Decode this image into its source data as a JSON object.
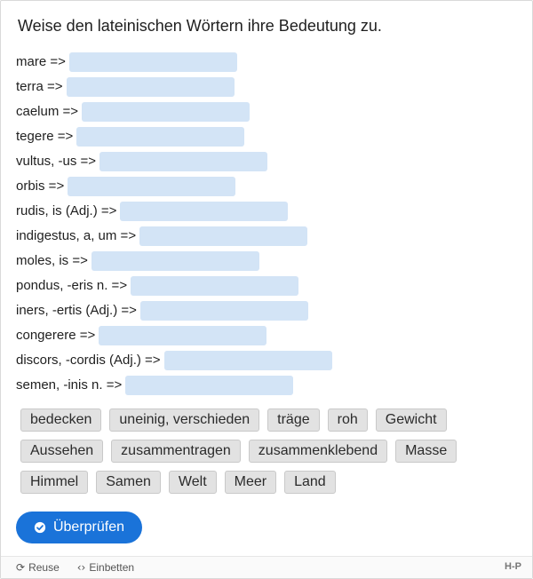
{
  "task": {
    "title": "Weise den lateinischen Wörtern ihre Bedeutung zu."
  },
  "rows": [
    {
      "word": "mare =>"
    },
    {
      "word": "terra =>"
    },
    {
      "word": "caelum =>"
    },
    {
      "word": "tegere =>"
    },
    {
      "word": "vultus, -us =>"
    },
    {
      "word": "orbis =>"
    },
    {
      "word": "rudis, is (Adj.) =>"
    },
    {
      "word": "indigestus, a, um =>"
    },
    {
      "word": "moles, is =>"
    },
    {
      "word": "pondus, -eris n. =>"
    },
    {
      "word": "iners, -ertis (Adj.) =>"
    },
    {
      "word": "congerere =>"
    },
    {
      "word": "discors, -cordis (Adj.) =>"
    },
    {
      "word": "semen, -inis n. =>"
    }
  ],
  "chips": [
    [
      "bedecken",
      "uneinig, verschieden",
      "träge",
      "roh",
      "Gewicht"
    ],
    [
      "Aussehen",
      "zusammentragen",
      "zusammenklebend",
      "Masse"
    ],
    [
      "Himmel",
      "Samen",
      "Welt",
      "Meer",
      "Land"
    ]
  ],
  "check_button": {
    "label": "Überprüfen",
    "icon": "check-circle-icon"
  },
  "footer": {
    "reuse": "Reuse",
    "embed": "Einbetten",
    "logo": "H-P"
  },
  "colors": {
    "accent": "#1a73d9",
    "dropzone": "#d3e4f6",
    "chip_bg": "#e2e2e2"
  }
}
